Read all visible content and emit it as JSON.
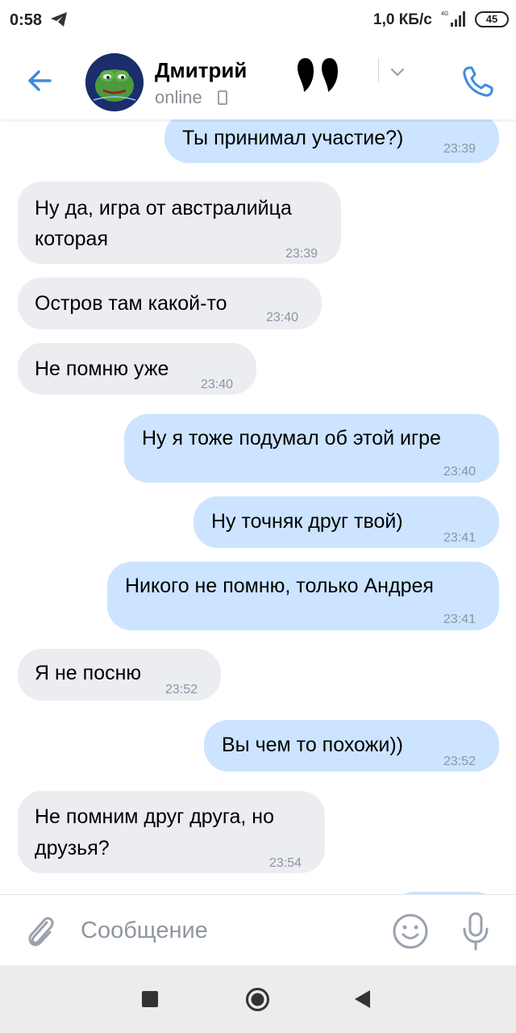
{
  "status_bar": {
    "time": "0:58",
    "speed": "1,0 КБ/с",
    "battery": "45"
  },
  "header": {
    "contact_name": "Дмитрий",
    "status": "online"
  },
  "messages": [
    {
      "dir": "out",
      "lines": [
        "Ты принимал участие?)"
      ],
      "time": "23:39"
    },
    {
      "dir": "in",
      "lines": [
        "Ну да, игра от австралийца",
        "которая"
      ],
      "time": "23:39"
    },
    {
      "dir": "in",
      "lines": [
        "Остров там какой-то"
      ],
      "time": "23:40"
    },
    {
      "dir": "in",
      "lines": [
        "Не помню уже"
      ],
      "time": "23:40"
    },
    {
      "dir": "out",
      "lines": [
        "Ну я тоже подумал об этой игре"
      ],
      "time": "23:40"
    },
    {
      "dir": "out",
      "lines": [
        "Ну точняк друг твой)"
      ],
      "time": "23:41"
    },
    {
      "dir": "out",
      "lines": [
        "Никого не помню, только Андрея"
      ],
      "time": "23:41"
    },
    {
      "dir": "in",
      "lines": [
        "Я не посню"
      ],
      "time": "23:52"
    },
    {
      "dir": "out",
      "lines": [
        "Вы чем то похожи))"
      ],
      "time": "23:52"
    },
    {
      "dir": "in",
      "lines": [
        "Не помним друг друга, но",
        "друзья?"
      ],
      "time": "23:54"
    }
  ],
  "composer": {
    "placeholder": "Сообщение"
  },
  "colors": {
    "accent": "#3f8ae0",
    "incoming_bubble": "#ebedf0",
    "outgoing_bubble": "#cce4ff",
    "time_text": "#8a95a3"
  },
  "icons": {
    "status": [
      "telegram-icon",
      "signal-4g-icon",
      "battery-icon"
    ],
    "header": [
      "back-arrow-icon",
      "chevron-down-icon",
      "phone-icon"
    ],
    "composer": [
      "paperclip-icon",
      "smile-icon",
      "microphone-icon"
    ],
    "nav": [
      "recent-apps-icon",
      "home-icon",
      "back-icon"
    ]
  }
}
